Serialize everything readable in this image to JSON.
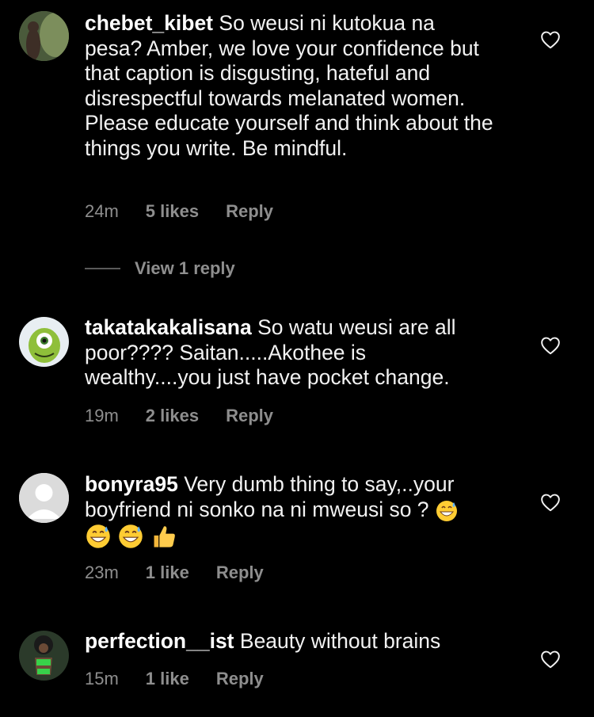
{
  "comments": [
    {
      "username": "chebet_kibet",
      "text": "So weusi ni kutokua na pesa? Amber, we love your confidence but that caption is disgusting, hateful and disrespectful towards melanated women. Please educate yourself and think about the things you write. Be mindful.",
      "time": "24m",
      "likes": "5 likes",
      "reply": "Reply",
      "view_replies": "View 1 reply"
    },
    {
      "username": "takatakakalisana",
      "text": "So watu weusi are all poor???? Saitan.....Akothee is wealthy....you just have pocket change.",
      "time": "19m",
      "likes": "2 likes",
      "reply": "Reply"
    },
    {
      "username": "bonyra95",
      "text": "Very dumb thing to say,..your boyfriend ni sonko na ni mweusi so ?",
      "time": "23m",
      "likes": "1 like",
      "reply": "Reply"
    },
    {
      "username": "perfection__ist",
      "text": "Beauty without brains",
      "time": "15m",
      "likes": "1 like",
      "reply": "Reply"
    }
  ],
  "colors": {
    "background": "#000000",
    "text": "#f2f2f2",
    "muted": "#8e8e8e"
  },
  "icons": [
    "heart-outline-icon",
    "grinning-sweat-emoji",
    "thumbs-up-emoji",
    "default-avatar-icon"
  ]
}
